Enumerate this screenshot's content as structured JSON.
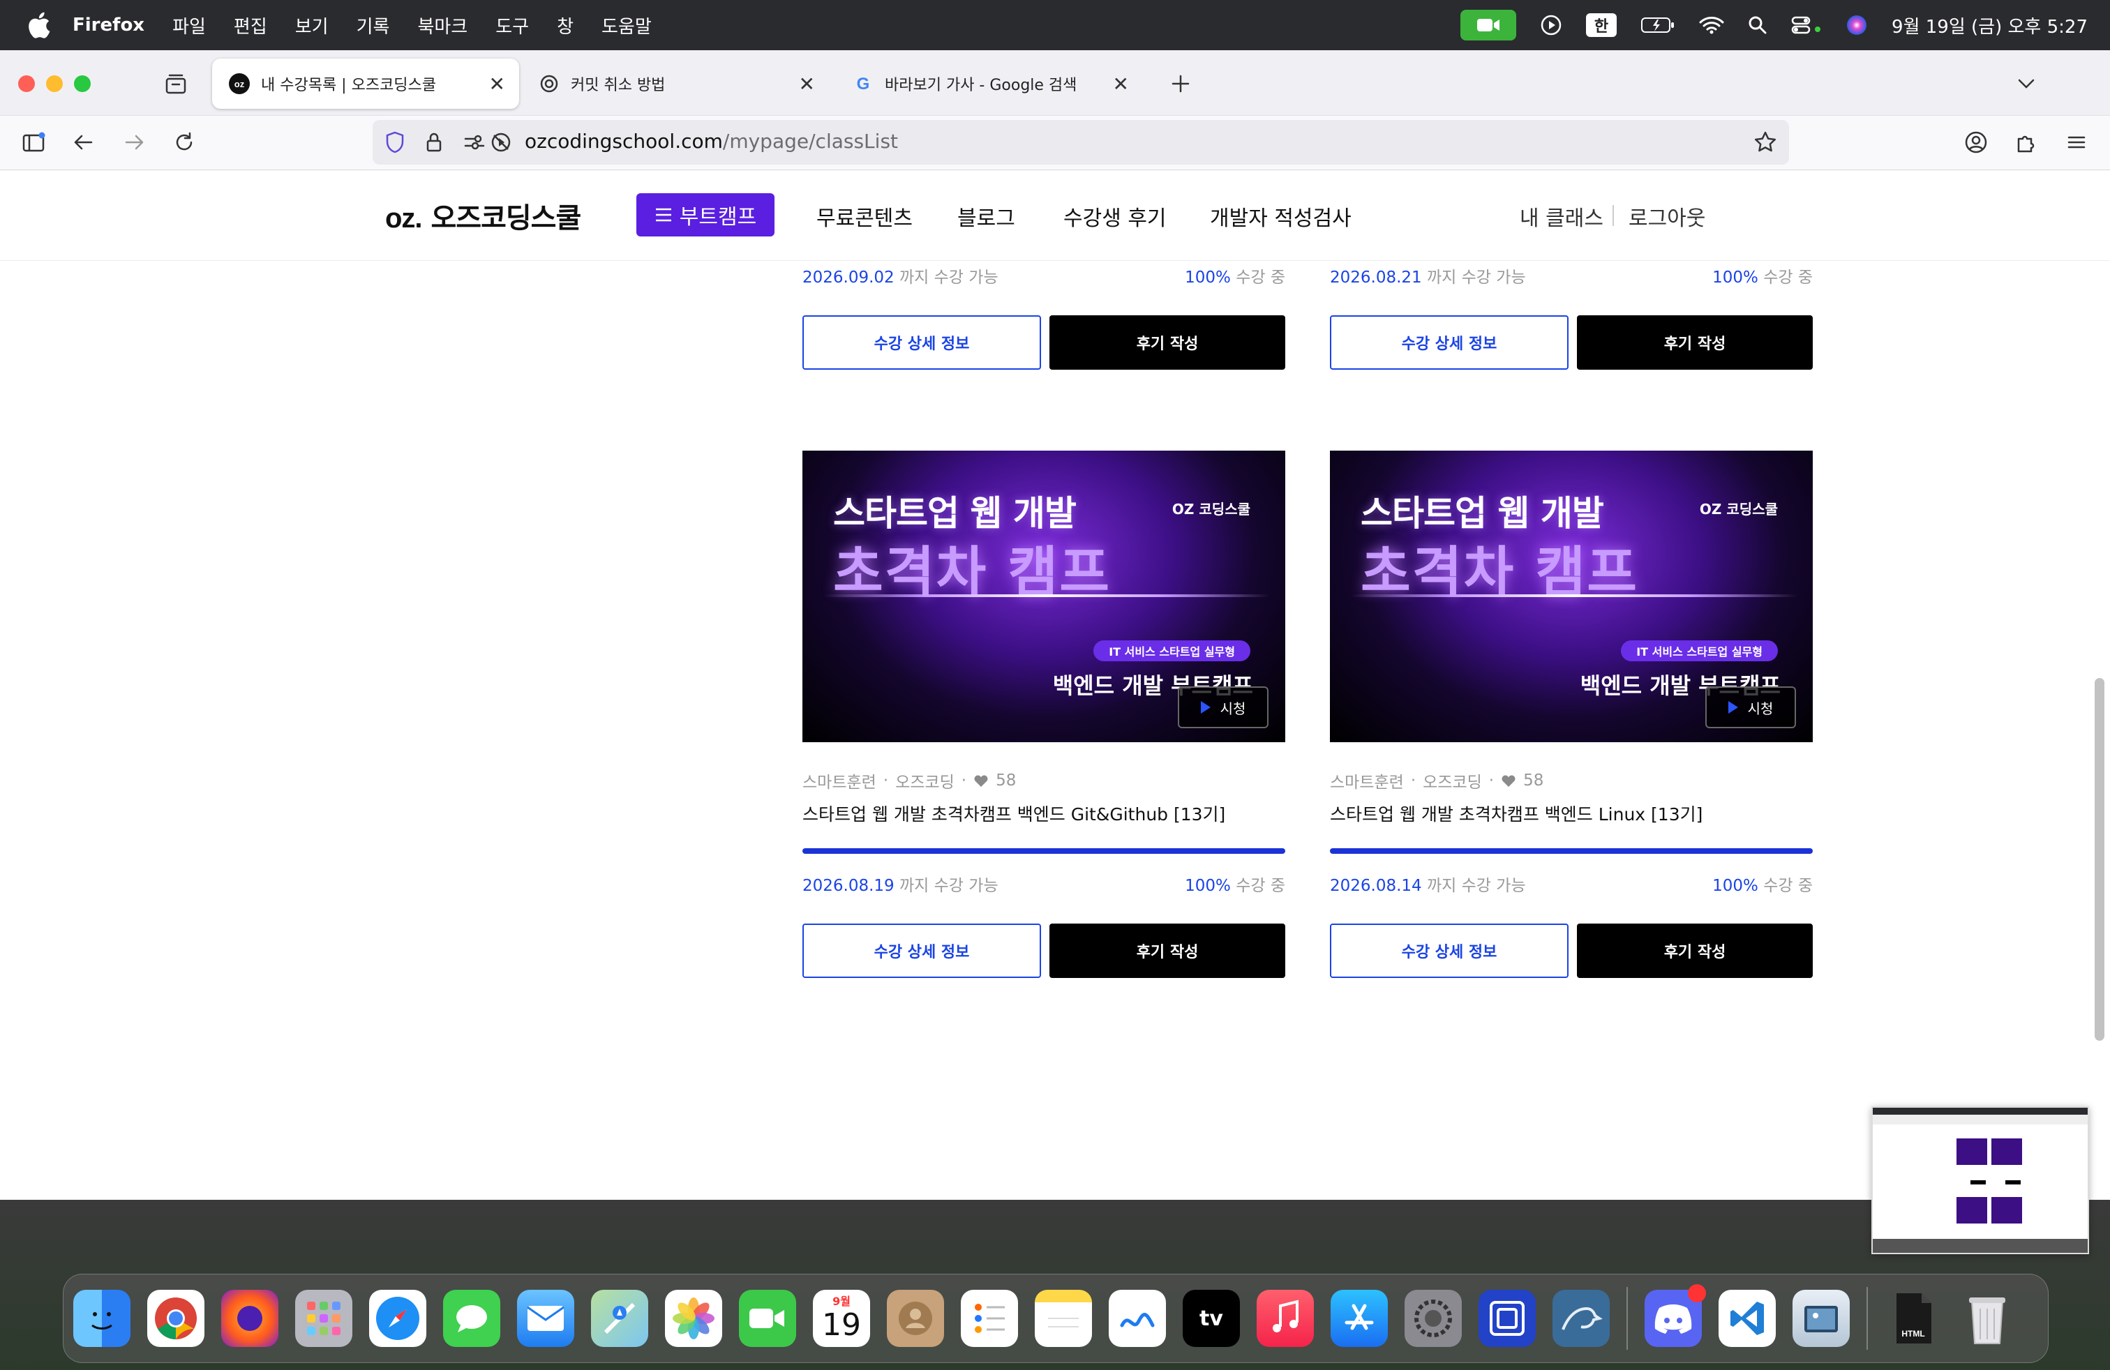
{
  "menubar": {
    "app": "Firefox",
    "items": [
      "파일",
      "편집",
      "보기",
      "기록",
      "북마크",
      "도구",
      "창",
      "도움말"
    ],
    "input_source": "한",
    "datetime": "9월 19일 (금) 오후 5:27"
  },
  "tabs": [
    {
      "title": "내 수강목록 | 오즈코딩스쿨",
      "active": true
    },
    {
      "title": "커밋 취소 방법",
      "active": false
    },
    {
      "title": "바라보기 가사 - Google 검색",
      "active": false
    }
  ],
  "url": {
    "host": "ozcodingschool.com",
    "path": "/mypage/classList"
  },
  "site": {
    "logo_oz": "oz.",
    "logo_name": "오즈코딩스쿨",
    "bootcamp_btn": "부트캠프",
    "nav": [
      "무료콘텐츠",
      "블로그",
      "수강생 후기",
      "개발자 적성검사"
    ],
    "my_class": "내 클래스",
    "logout": "로그아웃"
  },
  "cards_top": [
    {
      "date": "2026.09.02",
      "until": "까지 수강 가능",
      "progress": "100%",
      "status": "수강 중"
    },
    {
      "date": "2026.08.21",
      "until": "까지 수강 가능",
      "progress": "100%",
      "status": "수강 중"
    }
  ],
  "buttons": {
    "detail": "수강 상세 정보",
    "review": "후기 작성"
  },
  "thumb": {
    "title1": "스타트업 웹 개발",
    "title2": "초격차 캠프",
    "brand": "OZ 코딩스쿨",
    "pill": "IT 서비스 스타트업 실무형",
    "sub": "백엔드 개발 부트캠프",
    "watch": "시청"
  },
  "cards_bottom": [
    {
      "cat1": "스마트훈련",
      "cat2": "오즈코딩",
      "likes": "58",
      "title": "스타트업 웹 개발 초격차캠프 백엔드 Git&Github [13기]",
      "progress_fraction": 1.0,
      "date": "2026.08.19",
      "until": "까지 수강 가능",
      "progress": "100%",
      "status": "수강 중"
    },
    {
      "cat1": "스마트훈련",
      "cat2": "오즈코딩",
      "likes": "58",
      "title": "스타트업 웹 개발 초격차캠프 백엔드 Linux [13기]",
      "progress_fraction": 1.0,
      "date": "2026.08.14",
      "until": "까지 수강 가능",
      "progress": "100%",
      "status": "수강 중"
    }
  ],
  "dock": {
    "calendar_month": "9월",
    "calendar_day": "19",
    "appletv": "tv",
    "apps": [
      "finder",
      "chrome",
      "firefox",
      "launchpad",
      "safari",
      "messages",
      "mail",
      "maps",
      "photos",
      "facetime",
      "calendar",
      "contacts",
      "reminders",
      "notes",
      "freeform",
      "tv",
      "music",
      "app-store",
      "system-settings",
      "simulator",
      "mysql-workbench",
      "discord",
      "vscode",
      "preview",
      "html-file",
      "trash"
    ]
  },
  "colors": {
    "accent": "#1a44e6",
    "brand": "#5a1fe0",
    "progress": "#1a33d6"
  }
}
